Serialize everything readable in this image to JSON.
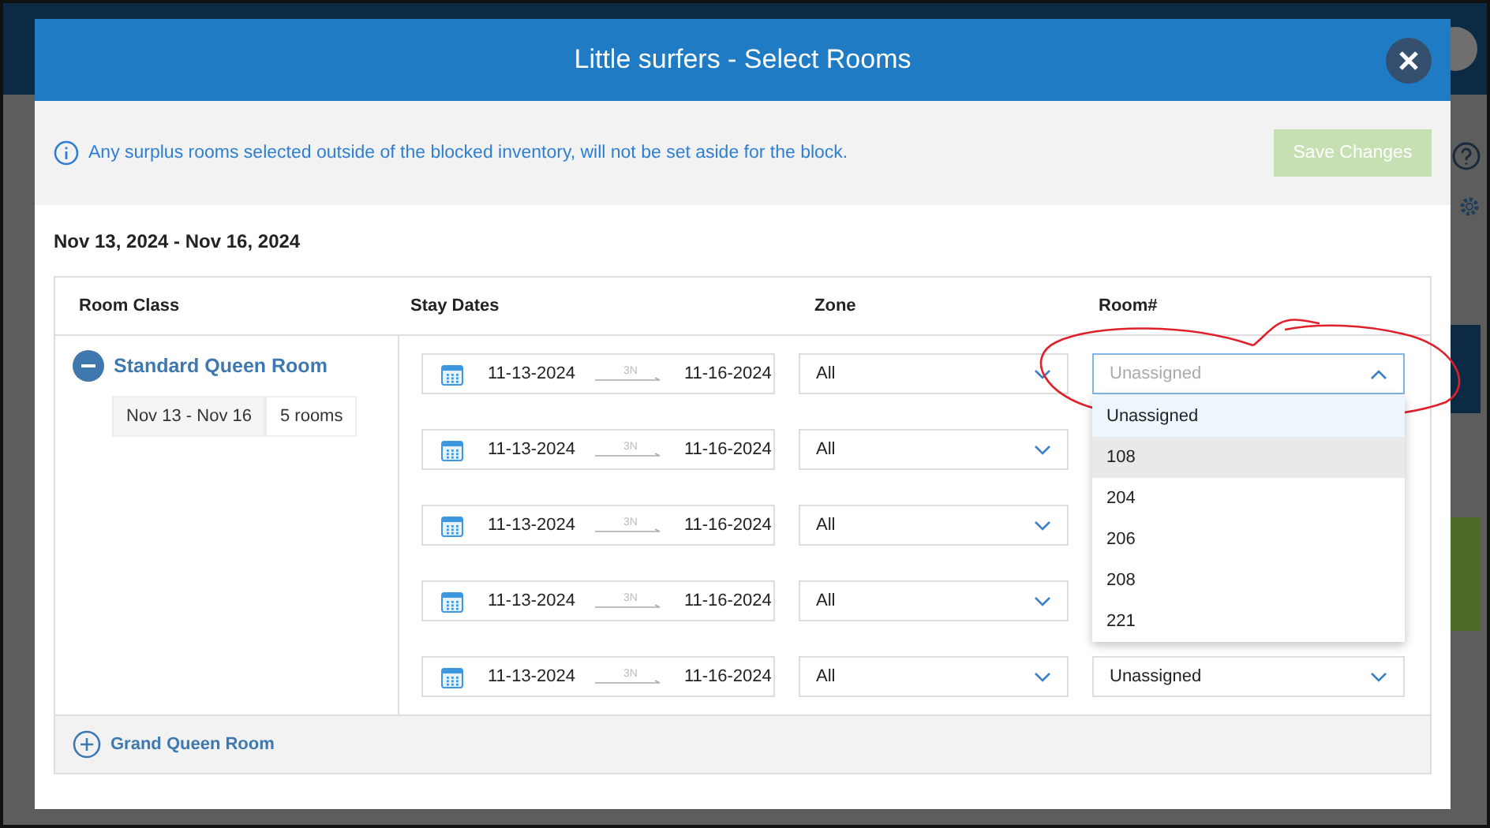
{
  "dialog": {
    "title": "Little surfers - Select Rooms",
    "notice": "Any surplus rooms selected outside of the blocked inventory, will not be set aside for the block.",
    "save_button": {
      "label": "Save Changes",
      "disabled": true
    },
    "date_range": "Nov 13, 2024 - Nov 16, 2024",
    "table": {
      "columns": [
        "Room Class",
        "Stay Dates",
        "Zone",
        "Room#"
      ],
      "room_classes": [
        {
          "name": "Standard Queen Room",
          "expanded": true,
          "dates": "Nov 13 - Nov 16",
          "count": "5 rooms",
          "rows": [
            {
              "check_in": "11-13-2024",
              "nights": "3N",
              "check_out": "11-16-2024",
              "zone": "All",
              "room_placeholder": "Unassigned",
              "open": true,
              "options": [
                {
                  "label": "Unassigned",
                  "selected": true,
                  "hovered": false
                },
                {
                  "label": "108",
                  "selected": false,
                  "hovered": true
                },
                {
                  "label": "204",
                  "selected": false,
                  "hovered": false
                },
                {
                  "label": "206",
                  "selected": false,
                  "hovered": false
                },
                {
                  "label": "208",
                  "selected": false,
                  "hovered": false
                },
                {
                  "label": "221",
                  "selected": false,
                  "hovered": false
                }
              ]
            },
            {
              "check_in": "11-13-2024",
              "nights": "3N",
              "check_out": "11-16-2024",
              "zone": "All"
            },
            {
              "check_in": "11-13-2024",
              "nights": "3N",
              "check_out": "11-16-2024",
              "zone": "All"
            },
            {
              "check_in": "11-13-2024",
              "nights": "3N",
              "check_out": "11-16-2024",
              "zone": "All"
            },
            {
              "check_in": "11-13-2024",
              "nights": "3N",
              "check_out": "11-16-2024",
              "zone": "All",
              "room": "Unassigned",
              "open": false
            }
          ]
        },
        {
          "name": "Grand Queen Room",
          "expanded": false
        }
      ]
    }
  }
}
